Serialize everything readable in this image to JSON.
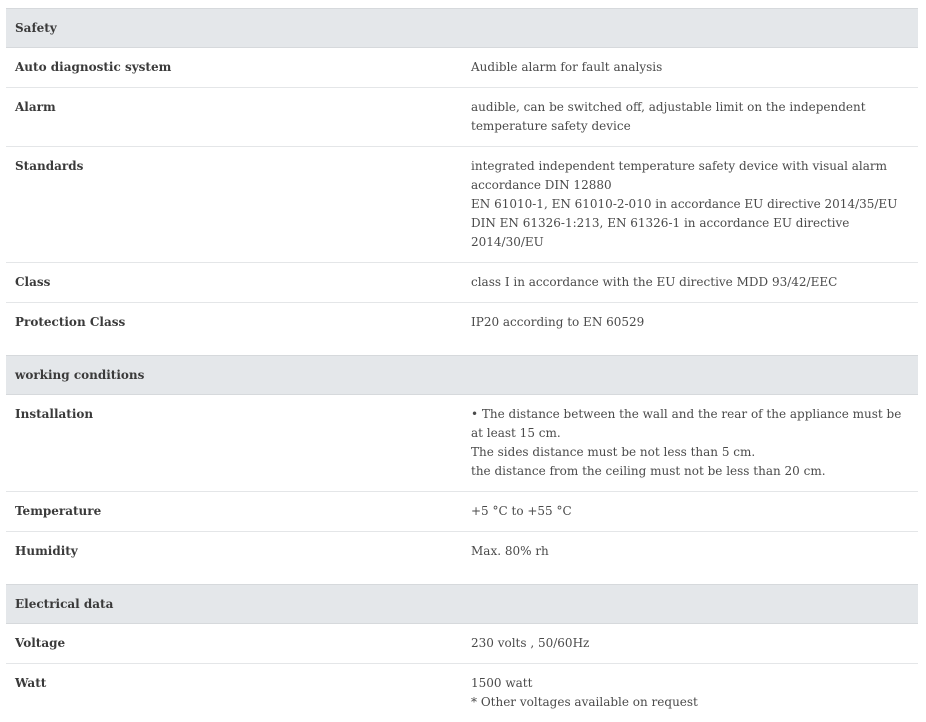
{
  "sections": [
    {
      "title": "Safety",
      "rows": [
        {
          "label": "Auto diagnostic system",
          "lines": [
            "Audible alarm for fault analysis"
          ]
        },
        {
          "label": "Alarm",
          "lines": [
            "audible, can be switched off, adjustable limit on the independent temperature safety device"
          ]
        },
        {
          "label": "Standards",
          "lines": [
            "integrated independent temperature safety device with visual alarm accordance DIN 12880",
            "EN 61010-1, EN 61010-2-010 in accordance EU directive 2014/35/EU",
            "DIN EN 61326-1:213, EN 61326-1 in accordance EU directive 2014/30/EU"
          ]
        },
        {
          "label": "Class",
          "lines": [
            "class I in accordance with the EU directive MDD 93/42/EEC"
          ]
        },
        {
          "label": "Protection Class",
          "lines": [
            "IP20 according to EN 60529"
          ]
        }
      ]
    },
    {
      "title": "working conditions",
      "rows": [
        {
          "label": "Installation",
          "lines": [
            "• The distance between the wall and the rear of the appliance must be at least 15 cm.",
            "The sides distance must be not less than 5 cm.",
            "the distance from the ceiling must not be less than 20 cm."
          ]
        },
        {
          "label": "Temperature",
          "lines": [
            "+5 °C to +55 °C"
          ]
        },
        {
          "label": "Humidity",
          "lines": [
            "Max. 80% rh"
          ]
        }
      ]
    },
    {
      "title": "Electrical data",
      "rows": [
        {
          "label": "Voltage",
          "lines": [
            "230 volts , 50/60Hz"
          ]
        },
        {
          "label": "Watt",
          "lines": [
            "1500 watt",
            "* Other voltages available on request"
          ]
        }
      ]
    }
  ]
}
